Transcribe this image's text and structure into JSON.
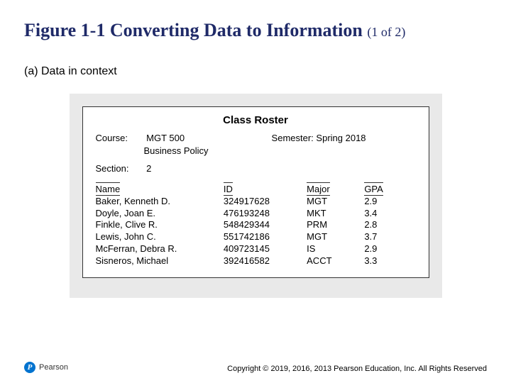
{
  "title_main": "Figure 1-1 Converting Data to Information",
  "title_part": "(1 of 2)",
  "subtitle": "(a) Data in context",
  "roster": {
    "heading": "Class Roster",
    "course_label": "Course:",
    "course_code": "MGT 500",
    "course_name": "Business Policy",
    "semester_label": "Semester:",
    "semester_value": "Spring 2018",
    "section_label": "Section:",
    "section_value": "2",
    "columns": {
      "name": "Name",
      "id": "ID",
      "major": "Major",
      "gpa": "GPA"
    },
    "rows": [
      {
        "name": "Baker, Kenneth D.",
        "id": "324917628",
        "major": "MGT",
        "gpa": "2.9"
      },
      {
        "name": "Doyle, Joan E.",
        "id": "476193248",
        "major": "MKT",
        "gpa": "3.4"
      },
      {
        "name": "Finkle, Clive R.",
        "id": "548429344",
        "major": "PRM",
        "gpa": "2.8"
      },
      {
        "name": "Lewis, John C.",
        "id": "551742186",
        "major": "MGT",
        "gpa": "3.7"
      },
      {
        "name": "McFerran, Debra R.",
        "id": "409723145",
        "major": "IS",
        "gpa": "2.9"
      },
      {
        "name": "Sisneros, Michael",
        "id": "392416582",
        "major": "ACCT",
        "gpa": "3.3"
      }
    ]
  },
  "brand": {
    "letter": "P",
    "name": "Pearson"
  },
  "copyright": "Copyright © 2019, 2016, 2013 Pearson Education, Inc. All Rights Reserved"
}
